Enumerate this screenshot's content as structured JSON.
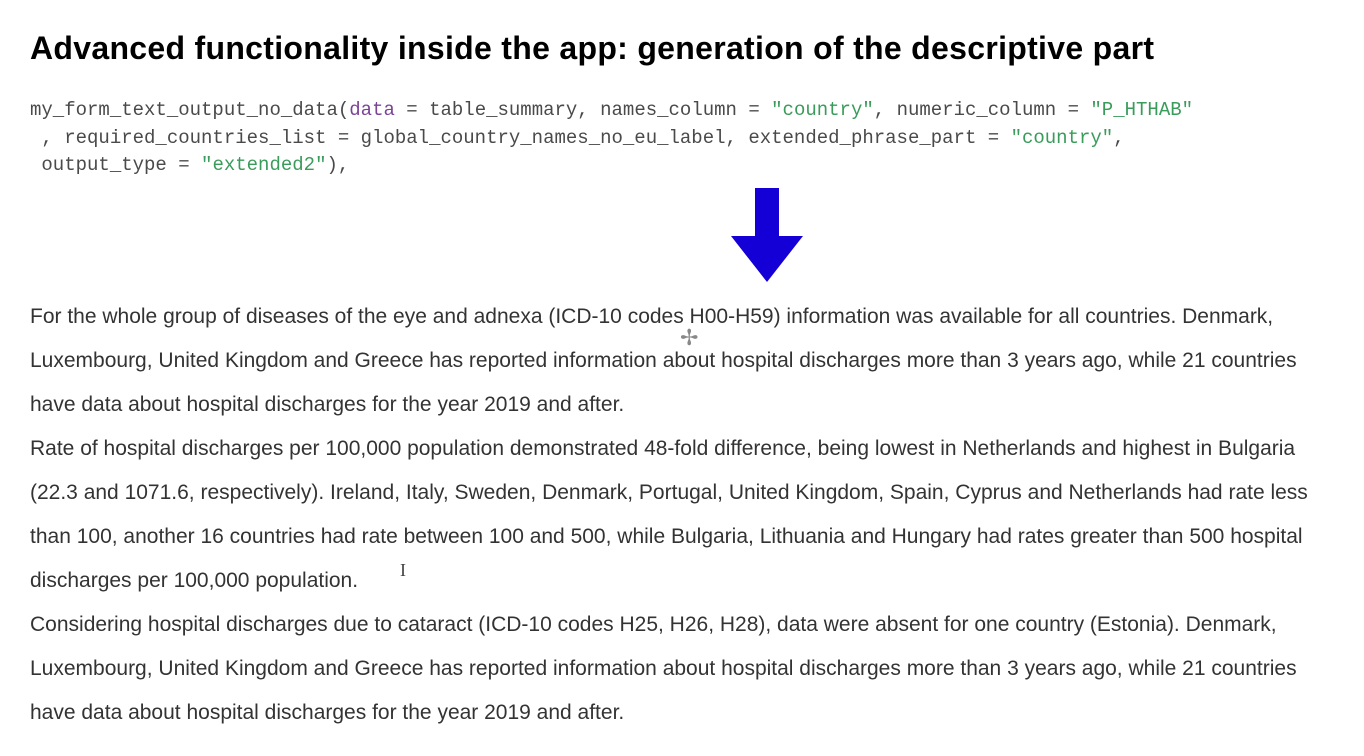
{
  "heading": "Advanced functionality inside the app: generation of the descriptive part",
  "code": {
    "func": "my_form_text_output_no_data",
    "p_data_k": "data",
    "p_data_v": " = table_summary, names_column = ",
    "p_names_v": "\"country\"",
    "p_numeric_k": ", numeric_column = ",
    "p_numeric_v": "\"P_HTHAB\"",
    "line2a": " , required_countries_list = global_country_names_no_eu_label, extended_phrase_part = ",
    "p_ext_v": "\"country\"",
    "line2b": ",",
    "line3a": " output_type = ",
    "p_out_v": "\"extended2\"",
    "line3b": "),"
  },
  "prose": {
    "p1": "For the whole group of diseases of the eye and adnexa (ICD-10 codes H00-H59) information was available for all countries. Denmark, Luxembourg, United Kingdom and Greece has reported information about hospital discharges more than 3 years ago, while 21 countries have data about hospital discharges for the year 2019 and after.",
    "p2": "Rate of hospital discharges per 100,000 population demonstrated 48-fold difference, being lowest in Netherlands and highest in Bulgaria (22.3 and 1071.6, respectively). Ireland, Italy, Sweden, Denmark, Portugal, United Kingdom, Spain, Cyprus and Netherlands had rate less than 100, another 16 countries had rate between 100 and 500, while Bulgaria, Lithuania and Hungary had rates greater than 500 hospital discharges per 100,000 population.",
    "p3": "Considering hospital discharges due to cataract (ICD-10 codes H25, H26, H28), data were absent for one country (Estonia). Denmark, Luxembourg, United Kingdom and Greece has reported information about hospital discharges more than 3 years ago, while 21 countries have data about hospital discharges for the year 2019 and after."
  },
  "arrow_color": "#1400d6"
}
